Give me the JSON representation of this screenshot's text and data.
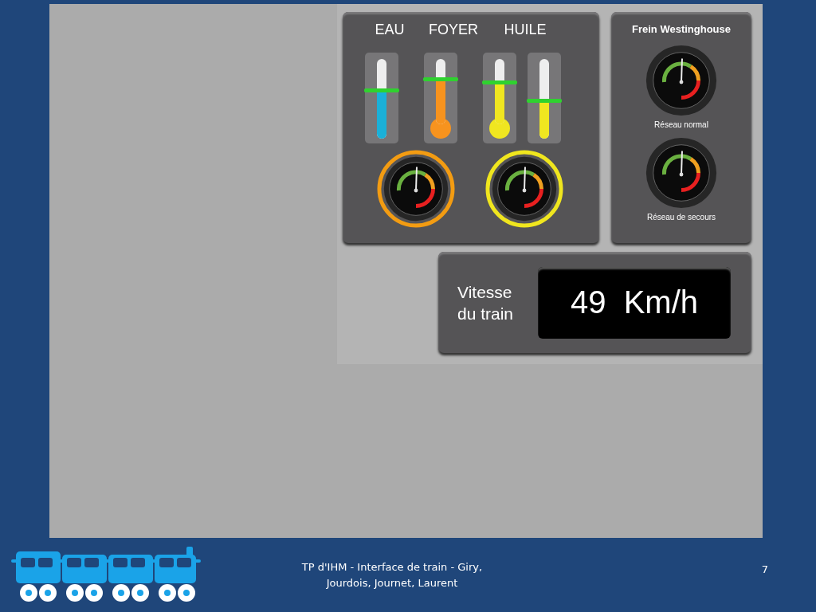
{
  "dashboard": {
    "levels": {
      "labels": [
        "EAU",
        "FOYER",
        "HUILE"
      ],
      "thermometers": [
        {
          "kind": "bar",
          "color": "#1ab0d8",
          "level": 0.6
        },
        {
          "kind": "bulb",
          "color": "#f7931e",
          "level": 0.68
        },
        {
          "kind": "bulb",
          "color": "#f0e620",
          "level": 0.64
        },
        {
          "kind": "bar",
          "color": "#f0e620",
          "level": 0.47
        }
      ],
      "dials": [
        {
          "color": "#f39c12"
        },
        {
          "color": "#f0e61e"
        }
      ]
    },
    "brake": {
      "title": "Frein Westinghouse",
      "gauges": [
        {
          "label": "Réseau normal"
        },
        {
          "label": "Réseau de secours"
        }
      ]
    },
    "speed": {
      "label": "Vitesse du train",
      "value": "49  Km/h"
    }
  },
  "footer": {
    "text": "TP d'IHM - Interface de train - Giry, Jourdois, Journet, Laurent",
    "page": "7"
  }
}
